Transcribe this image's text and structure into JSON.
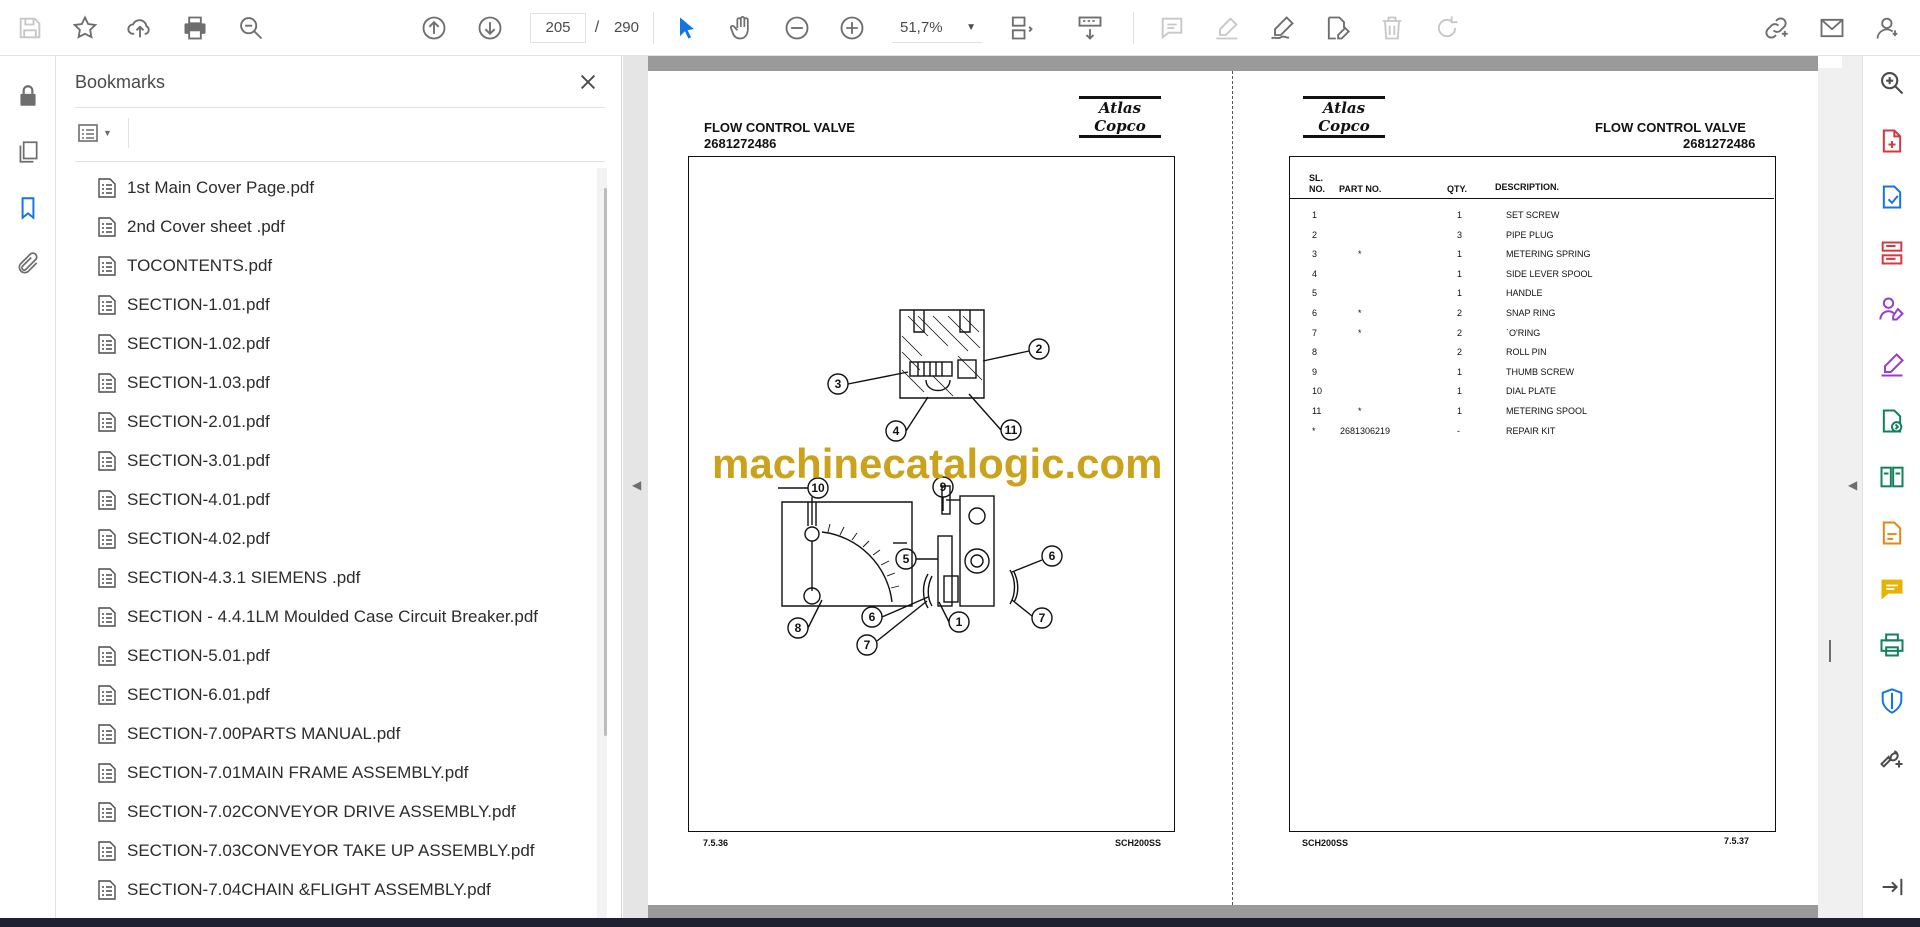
{
  "toolbar": {
    "current_page": "205",
    "page_separator": "/",
    "total_pages": "290",
    "zoom": "51,7%"
  },
  "bookmarks": {
    "title": "Bookmarks",
    "items": [
      "1st Main Cover Page.pdf",
      "2nd Cover sheet .pdf",
      "TOCONTENTS.pdf",
      "SECTION-1.01.pdf",
      "SECTION-1.02.pdf",
      "SECTION-1.03.pdf",
      "SECTION-2.01.pdf",
      "SECTION-3.01.pdf",
      "SECTION-4.01.pdf",
      "SECTION-4.02.pdf",
      "SECTION-4.3.1 SIEMENS .pdf",
      "SECTION - 4.4.1LM Moulded Case Circuit Breaker.pdf",
      "SECTION-5.01.pdf",
      "SECTION-6.01.pdf",
      "SECTION-7.00PARTS MANUAL.pdf",
      "SECTION-7.01MAIN FRAME ASSEMBLY.pdf",
      "SECTION-7.02CONVEYOR DRIVE  ASSEMBLY.pdf",
      "SECTION-7.03CONVEYOR TAKE UP  ASSEMBLY.pdf",
      "SECTION-7.04CHAIN &FLIGHT  ASSEMBLY.pdf"
    ]
  },
  "document": {
    "left_page": {
      "title": "FLOW CONTROL VALVE",
      "part_number": "2681272486",
      "logo": "Atlas Copco",
      "footer_left": "7.5.36",
      "footer_right": "SCH200SS",
      "callouts": [
        "1",
        "2",
        "3",
        "4",
        "5",
        "6",
        "6",
        "7",
        "7",
        "8",
        "9",
        "10",
        "11"
      ]
    },
    "right_page": {
      "title": "FLOW CONTROL VALVE",
      "part_number": "2681272486",
      "logo": "Atlas Copco",
      "footer_left": "SCH200SS",
      "footer_right": "7.5.37",
      "headers": {
        "sl": "SL.",
        "no": "NO.",
        "part_no": "PART NO.",
        "qty": "QTY.",
        "description": "DESCRIPTION."
      },
      "rows": [
        {
          "sl": "1",
          "mark": "",
          "qty": "1",
          "desc": "SET SCREW"
        },
        {
          "sl": "2",
          "mark": "",
          "qty": "3",
          "desc": "PIPE PLUG"
        },
        {
          "sl": "3",
          "mark": "*",
          "qty": "1",
          "desc": "METERING SPRING"
        },
        {
          "sl": "4",
          "mark": "",
          "qty": "1",
          "desc": "SIDE LEVER SPOOL"
        },
        {
          "sl": "5",
          "mark": "",
          "qty": "1",
          "desc": "HANDLE"
        },
        {
          "sl": "6",
          "mark": "*",
          "qty": "2",
          "desc": "SNAP RING"
        },
        {
          "sl": "7",
          "mark": "*",
          "qty": "2",
          "desc": "`O'RING"
        },
        {
          "sl": "8",
          "mark": "",
          "qty": "2",
          "desc": "ROLL PIN"
        },
        {
          "sl": "9",
          "mark": "",
          "qty": "1",
          "desc": "THUMB SCREW"
        },
        {
          "sl": "10",
          "mark": "",
          "qty": "1",
          "desc": "DIAL PLATE"
        },
        {
          "sl": "11",
          "mark": "*",
          "qty": "1",
          "desc": "METERING SPOOL"
        },
        {
          "sl": "*",
          "mark": "2681306219",
          "qty": "-",
          "desc": "REPAIR KIT"
        }
      ]
    },
    "watermark": "machinecatalogic.com"
  },
  "icons": {
    "toolbar": [
      "save-icon",
      "star-icon",
      "upload-icon",
      "print-icon",
      "zoom-search-icon",
      "page-up-icon",
      "page-down-icon",
      "select-arrow-icon",
      "hand-icon",
      "zoom-out-icon",
      "zoom-in-icon",
      "page-layout-icon",
      "scroll-mode-icon",
      "comment-icon",
      "highlight-icon",
      "sign-icon",
      "edit-icon",
      "delete-icon",
      "redo-icon",
      "share-link-icon",
      "email-icon",
      "account-icon"
    ],
    "accent": "#1473e6"
  }
}
